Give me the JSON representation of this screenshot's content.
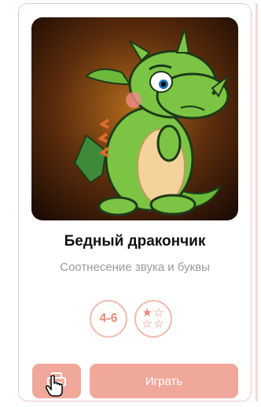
{
  "game": {
    "title": "Бедный дракончик",
    "subtitle": "Соотнесение звука и буквы",
    "age": "4-6",
    "difficulty_stars_filled": 1,
    "difficulty_stars_total": 4,
    "play_label": "Играть",
    "image_subject": "green-dragon"
  },
  "icons": {
    "print": "printer-icon",
    "cursor": "hand-pointer-icon"
  },
  "colors": {
    "accent": "#f0a89a",
    "badge_text": "#ea8b77",
    "subtitle": "#9a9a9a"
  }
}
